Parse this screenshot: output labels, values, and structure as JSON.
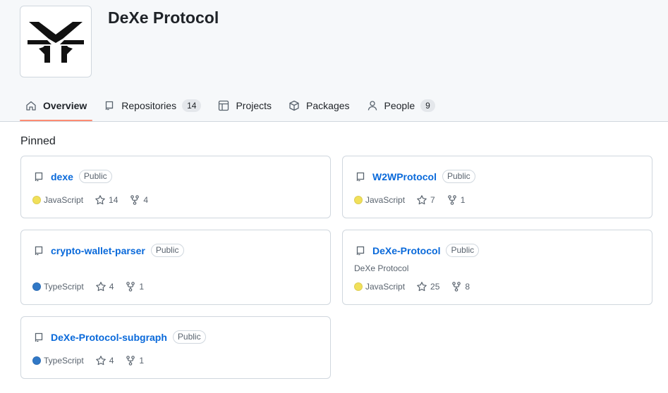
{
  "org": {
    "name": "DeXe Protocol",
    "logo_icon": "dexe-logo-icon"
  },
  "nav": [
    {
      "label": "Overview",
      "icon": "home-icon",
      "counter": ""
    },
    {
      "label": "Repositories",
      "icon": "repo-icon",
      "counter": "14"
    },
    {
      "label": "Projects",
      "icon": "table-icon",
      "counter": ""
    },
    {
      "label": "Packages",
      "icon": "package-icon",
      "counter": ""
    },
    {
      "label": "People",
      "icon": "person-icon",
      "counter": "9"
    }
  ],
  "colors": {
    "accent_underline": "#fd8c73",
    "link": "#0969da",
    "javascript": "#f1e05a",
    "typescript": "#3178c6"
  },
  "pinned": {
    "title": "Pinned",
    "repos": [
      {
        "name": "dexe",
        "visibility": "Public",
        "description": "",
        "language": "JavaScript",
        "stars": "14",
        "forks": "4"
      },
      {
        "name": "W2WProtocol",
        "visibility": "Public",
        "description": "",
        "language": "JavaScript",
        "stars": "7",
        "forks": "1"
      },
      {
        "name": "crypto-wallet-parser",
        "visibility": "Public",
        "description": "",
        "language": "TypeScript",
        "stars": "4",
        "forks": "1"
      },
      {
        "name": "DeXe-Protocol",
        "visibility": "Public",
        "description": "DeXe Protocol",
        "language": "JavaScript",
        "stars": "25",
        "forks": "8"
      },
      {
        "name": "DeXe-Protocol-subgraph",
        "visibility": "Public",
        "description": "",
        "language": "TypeScript",
        "stars": "4",
        "forks": "1"
      }
    ]
  }
}
